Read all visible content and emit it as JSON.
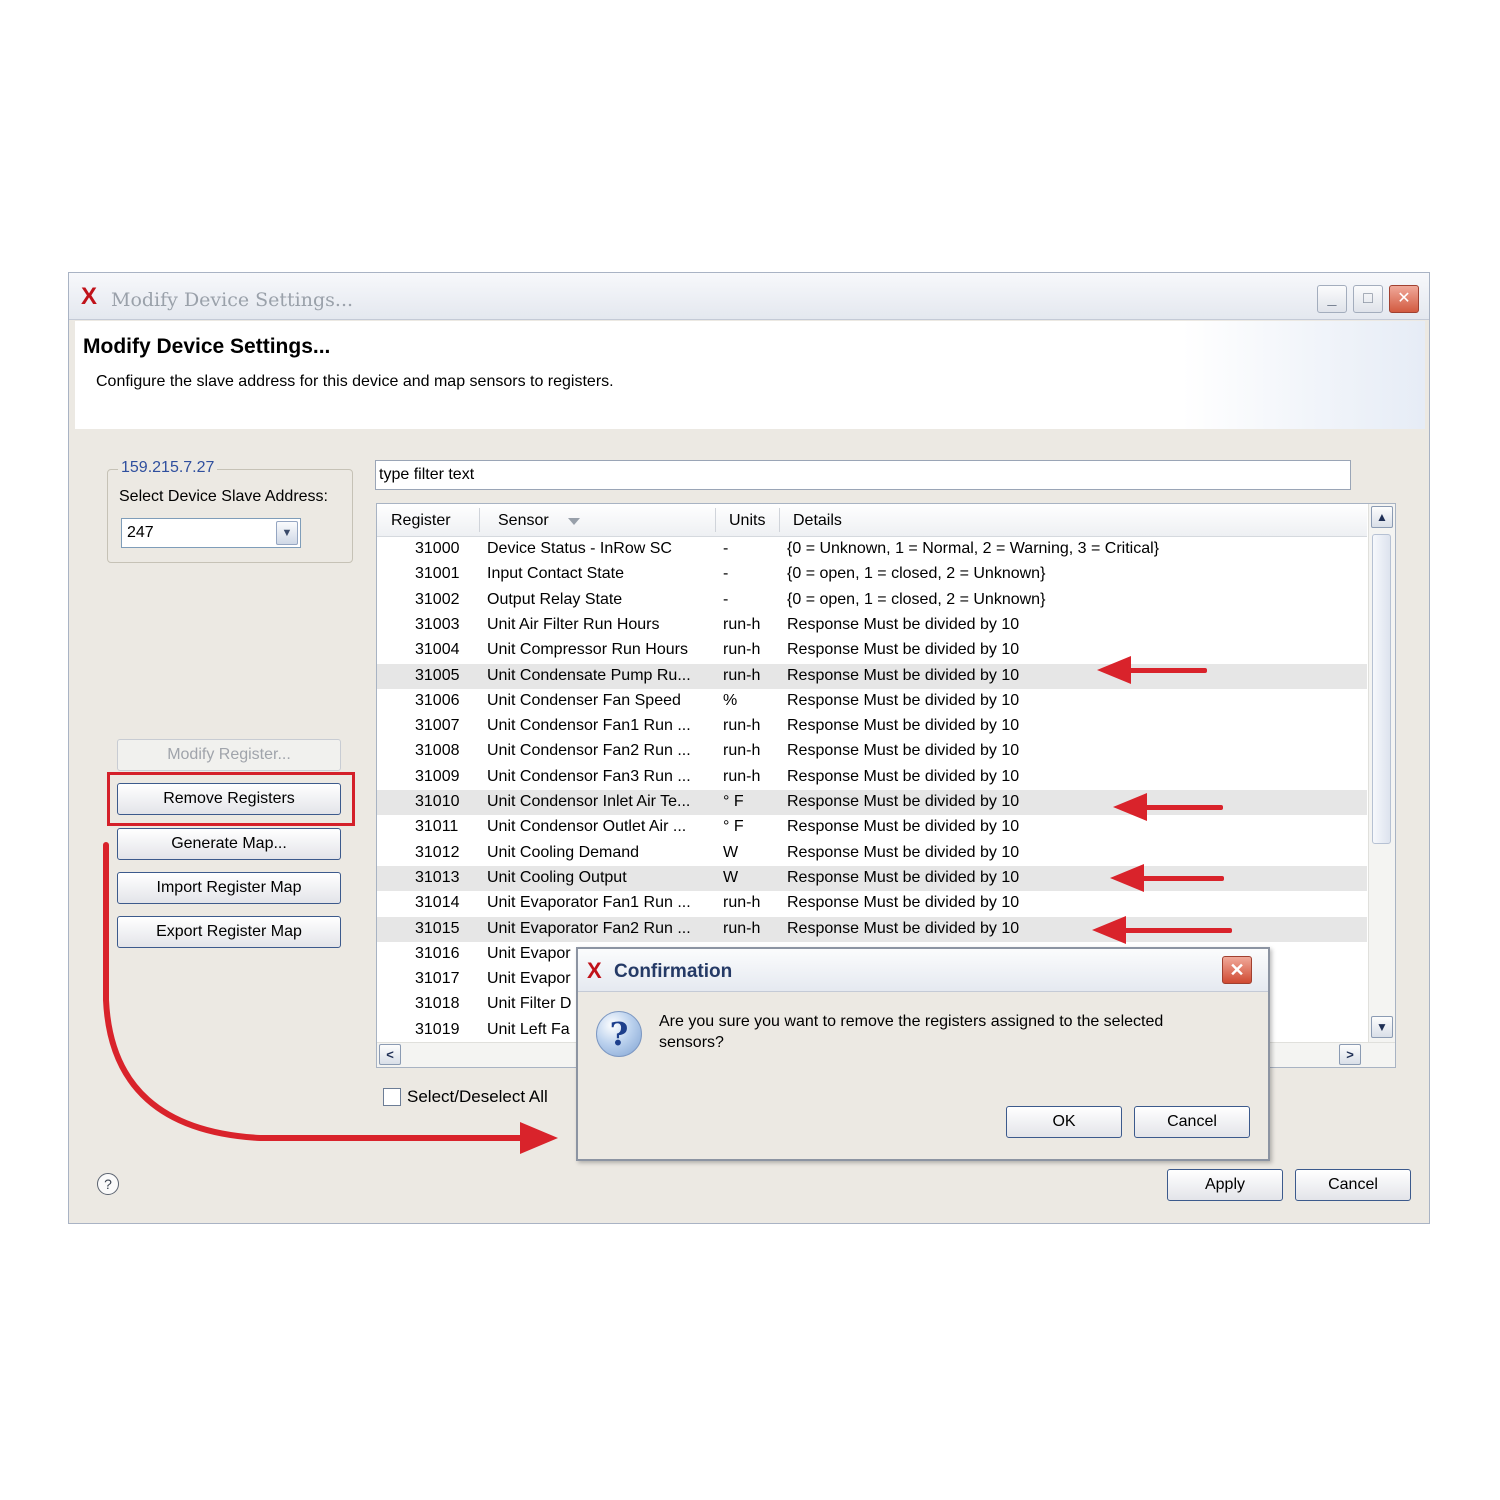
{
  "window": {
    "title": "Modify Device Settings...",
    "minimize_glyph": "_",
    "maximize_glyph": "□",
    "close_glyph": "✕"
  },
  "header": {
    "title": "Modify Device Settings...",
    "description": "Configure the slave address for this device and map sensors to registers."
  },
  "device": {
    "ip": "159.215.7.27",
    "slave_label": "Select Device Slave Address:",
    "slave_value": "247"
  },
  "side_buttons": {
    "modify": "Modify Register...",
    "remove": "Remove Registers",
    "generate": "Generate Map...",
    "import": "Import Register Map",
    "export": "Export Register Map"
  },
  "filter": {
    "placeholder": "type filter text"
  },
  "table": {
    "columns": [
      "Register",
      "Sensor",
      "Units",
      "Details"
    ],
    "rows": [
      {
        "register": "31000",
        "sensor": "Device Status - InRow SC",
        "units": "-",
        "details": "{0 = Unknown, 1 = Normal, 2 = Warning, 3 = Critical}",
        "selected": false
      },
      {
        "register": "31001",
        "sensor": "Input Contact State",
        "units": "-",
        "details": "{0 = open, 1 = closed, 2 = Unknown}",
        "selected": false
      },
      {
        "register": "31002",
        "sensor": "Output Relay State",
        "units": "-",
        "details": "{0 = open, 1 = closed, 2 = Unknown}",
        "selected": false
      },
      {
        "register": "31003",
        "sensor": "Unit Air Filter Run Hours",
        "units": "run-h",
        "details": "Response Must be divided by 10",
        "selected": false
      },
      {
        "register": "31004",
        "sensor": "Unit Compressor Run Hours",
        "units": "run-h",
        "details": "Response Must be divided by 10",
        "selected": false
      },
      {
        "register": "31005",
        "sensor": "Unit Condensate Pump Ru...",
        "units": "run-h",
        "details": "Response Must be divided by 10",
        "selected": true
      },
      {
        "register": "31006",
        "sensor": "Unit Condenser Fan Speed",
        "units": "%",
        "details": "Response Must be divided by 10",
        "selected": false
      },
      {
        "register": "31007",
        "sensor": "Unit Condensor Fan1 Run ...",
        "units": "run-h",
        "details": "Response Must be divided by 10",
        "selected": false
      },
      {
        "register": "31008",
        "sensor": "Unit Condensor Fan2 Run ...",
        "units": "run-h",
        "details": "Response Must be divided by 10",
        "selected": false
      },
      {
        "register": "31009",
        "sensor": "Unit Condensor Fan3 Run ...",
        "units": "run-h",
        "details": "Response Must be divided by 10",
        "selected": false
      },
      {
        "register": "31010",
        "sensor": "Unit Condensor Inlet Air Te...",
        "units": "° F",
        "details": "Response Must be divided by 10",
        "selected": true
      },
      {
        "register": "31011",
        "sensor": "Unit Condensor Outlet Air ...",
        "units": "° F",
        "details": "Response Must be divided by 10",
        "selected": false
      },
      {
        "register": "31012",
        "sensor": "Unit Cooling Demand",
        "units": "W",
        "details": "Response Must be divided by 10",
        "selected": false
      },
      {
        "register": "31013",
        "sensor": "Unit Cooling Output",
        "units": "W",
        "details": "Response Must be divided by 10",
        "selected": true
      },
      {
        "register": "31014",
        "sensor": "Unit Evaporator Fan1 Run ...",
        "units": "run-h",
        "details": "Response Must be divided by 10",
        "selected": false
      },
      {
        "register": "31015",
        "sensor": "Unit Evaporator Fan2 Run ...",
        "units": "run-h",
        "details": "Response Must be divided by 10",
        "selected": true
      },
      {
        "register": "31016",
        "sensor": "Unit Evapor",
        "units": "",
        "details": "",
        "selected": false
      },
      {
        "register": "31017",
        "sensor": "Unit Evapor",
        "units": "",
        "details": "",
        "selected": false
      },
      {
        "register": "31018",
        "sensor": "Unit Filter D",
        "units": "",
        "details": "",
        "selected": false
      },
      {
        "register": "31019",
        "sensor": "Unit Left Fa",
        "units": "",
        "details": "",
        "selected": false
      }
    ]
  },
  "select_all_label": "Select/Deselect All",
  "footer": {
    "apply": "Apply",
    "cancel": "Cancel",
    "help_glyph": "?"
  },
  "dialog": {
    "title": "Confirmation",
    "message": "Are you sure you want to remove the registers assigned to the selected sensors?",
    "ok": "OK",
    "cancel": "Cancel",
    "close_glyph": "✕",
    "icon_glyph": "?"
  },
  "colors": {
    "annotation_red": "#d9232b",
    "ip_link": "#2f4f9e",
    "window_bg": "#ece9e3",
    "selected_row": "#e6e6e6"
  },
  "icons": [
    "app-logo-icon",
    "minimize-icon",
    "maximize-icon",
    "close-icon",
    "dropdown-arrow-icon",
    "sort-arrow-icon",
    "question-icon",
    "help-icon"
  ]
}
